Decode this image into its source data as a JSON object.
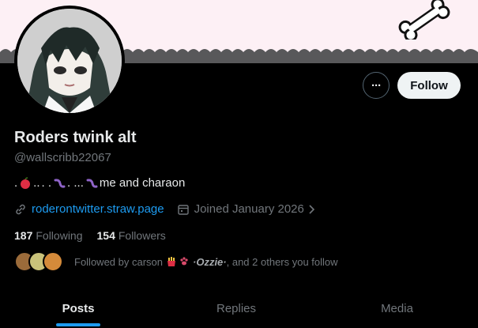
{
  "profile": {
    "name": "Roders twink alt",
    "handle": "@wallscribb22067",
    "bio_parts": [
      ". ",
      "..",
      " . . ",
      ". ...",
      " me and charaon"
    ],
    "website": "roderontwitter.straw.page",
    "joined": "Joined January 2026",
    "following_count": "187",
    "following_label": "Following",
    "followers_count": "154",
    "followers_label": "Followers",
    "followed_by_text": "Followed by carson",
    "followed_by_extra": "·Ozzie·",
    "followed_by_tail": ", and 2 others you follow"
  },
  "actions": {
    "more": "···",
    "follow": "Follow"
  },
  "tabs": [
    {
      "label": "Posts"
    },
    {
      "label": "Replies"
    },
    {
      "label": "Media"
    }
  ],
  "colors": {
    "accent": "#1d9bf0",
    "banner": "#fdf0f5",
    "muted": "#71767b",
    "text": "#e7e9ea"
  }
}
